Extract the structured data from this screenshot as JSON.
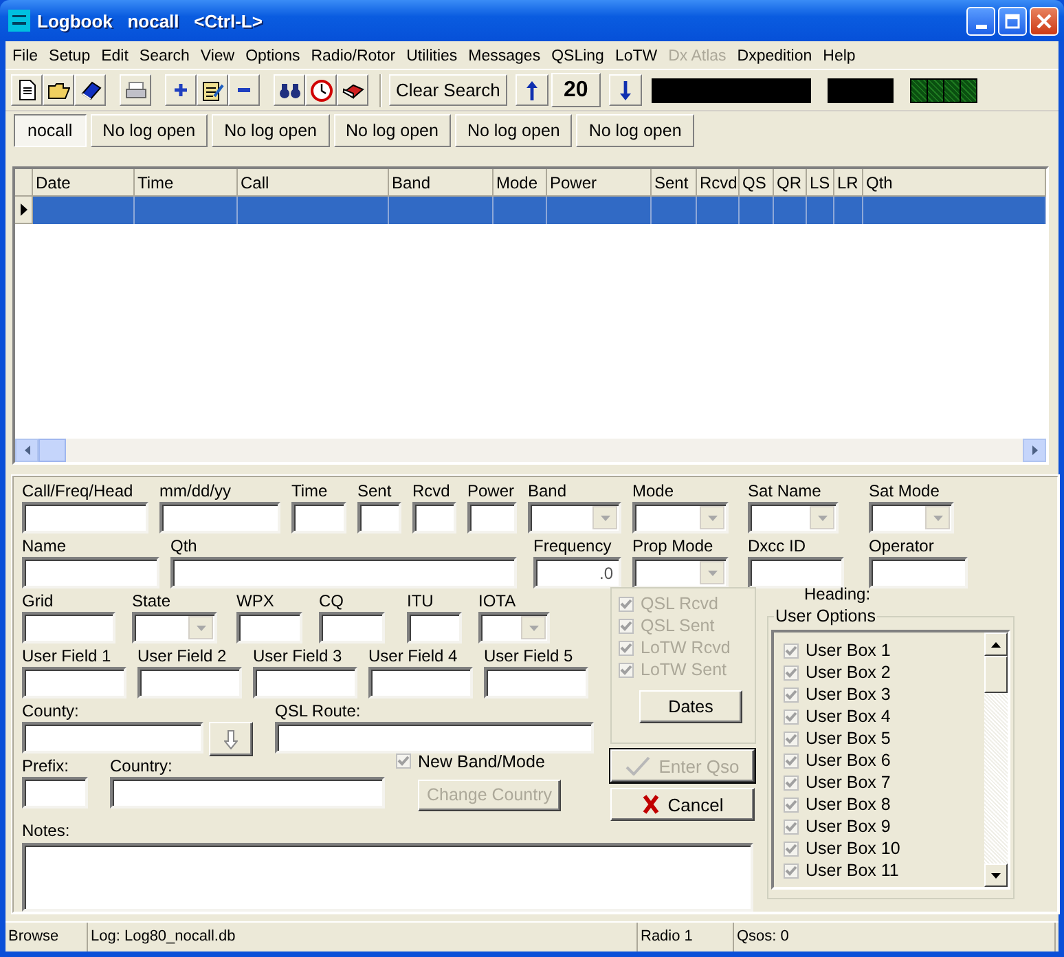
{
  "window": {
    "title": "Logbook   nocall   <Ctrl-L>"
  },
  "menu": [
    {
      "label": "File",
      "disabled": false
    },
    {
      "label": "Setup",
      "disabled": false
    },
    {
      "label": "Edit",
      "disabled": false
    },
    {
      "label": "Search",
      "disabled": false
    },
    {
      "label": "View",
      "disabled": false
    },
    {
      "label": "Options",
      "disabled": false
    },
    {
      "label": "Radio/Rotor",
      "disabled": false
    },
    {
      "label": "Utilities",
      "disabled": false
    },
    {
      "label": "Messages",
      "disabled": false
    },
    {
      "label": "QSLing",
      "disabled": false
    },
    {
      "label": "LoTW",
      "disabled": false
    },
    {
      "label": "Dx Atlas",
      "disabled": true
    },
    {
      "label": "Dxpedition",
      "disabled": false
    },
    {
      "label": "Help",
      "disabled": false
    }
  ],
  "toolbar": {
    "clear_search": "Clear Search",
    "counter": "20"
  },
  "tabs": [
    {
      "label": "nocall",
      "selected": true
    },
    {
      "label": "No log open",
      "selected": false
    },
    {
      "label": "No log open",
      "selected": false
    },
    {
      "label": "No log open",
      "selected": false
    },
    {
      "label": "No log open",
      "selected": false
    },
    {
      "label": "No log open",
      "selected": false
    }
  ],
  "table": {
    "columns": [
      "Date",
      "Time",
      "Call",
      "Band",
      "Mode",
      "Power",
      "Sent",
      "Rcvd",
      "QS",
      "QR",
      "LS",
      "LR",
      "Qth"
    ],
    "rows": [
      {
        "selected": true
      }
    ]
  },
  "form": {
    "line_1": [
      {
        "kind": "text",
        "label": "Call/Freq/Head"
      },
      {
        "kind": "text",
        "label": "mm/dd/yy"
      },
      {
        "kind": "text",
        "label": "Time"
      },
      {
        "kind": "text",
        "label": "Sent"
      },
      {
        "kind": "text",
        "label": "Rcvd"
      },
      {
        "kind": "text",
        "label": "Power"
      },
      {
        "kind": "combo",
        "label": "Band"
      },
      {
        "kind": "combo",
        "label": "Mode"
      },
      {
        "kind": "combo",
        "label": "Sat Name"
      },
      {
        "kind": "combo",
        "label": "Sat Mode"
      }
    ],
    "line_2": [
      {
        "kind": "text",
        "label": "Name"
      },
      {
        "kind": "text",
        "label": "Qth"
      },
      {
        "kind": "numeric",
        "label": "Frequency",
        "value": ".0"
      },
      {
        "kind": "combo",
        "label": "Prop Mode"
      },
      {
        "kind": "text",
        "label": "Dxcc ID"
      },
      {
        "kind": "text",
        "label": "Operator"
      }
    ],
    "line_3": [
      {
        "kind": "text",
        "label": "Grid"
      },
      {
        "kind": "combo",
        "label": "State"
      },
      {
        "kind": "text",
        "label": "WPX"
      },
      {
        "kind": "text",
        "label": "CQ"
      },
      {
        "kind": "text",
        "label": "ITU"
      },
      {
        "kind": "combo",
        "label": "IOTA"
      }
    ],
    "line_4": [
      {
        "kind": "text",
        "label": "User Field 1"
      },
      {
        "kind": "text",
        "label": "User Field 2"
      },
      {
        "kind": "text",
        "label": "User Field 3"
      },
      {
        "kind": "text",
        "label": "User Field 4"
      },
      {
        "kind": "text",
        "label": "User Field 5"
      }
    ],
    "county": {
      "label": "County:"
    },
    "qsl_route": {
      "label": "QSL Route:"
    },
    "prefix": {
      "label": "Prefix:"
    },
    "country": {
      "label": "Country:"
    },
    "new_band_mode": {
      "label": "New Band/Mode",
      "checked": true
    },
    "change_country": {
      "label": "Change Country",
      "disabled": true
    },
    "notes": {
      "label": "Notes:"
    },
    "qsl_flags": [
      {
        "label": "QSL Rcvd",
        "checked": true
      },
      {
        "label": "QSL Sent",
        "checked": true
      },
      {
        "label": "LoTW Rcvd",
        "checked": true
      },
      {
        "label": "LoTW Sent",
        "checked": true
      }
    ],
    "dates_button": "Dates",
    "enter_button": {
      "label": "Enter Qso",
      "disabled": true
    },
    "cancel_button": {
      "label": "Cancel",
      "disabled": false
    },
    "heading": "Heading:",
    "user_options": {
      "title": "User Options",
      "items": [
        {
          "label": "User Box 1",
          "checked": true
        },
        {
          "label": "User Box 2",
          "checked": true
        },
        {
          "label": "User Box 3",
          "checked": true
        },
        {
          "label": "User Box 4",
          "checked": true
        },
        {
          "label": "User Box 5",
          "checked": true
        },
        {
          "label": "User Box 6",
          "checked": true
        },
        {
          "label": "User Box 7",
          "checked": true
        },
        {
          "label": "User Box 8",
          "checked": true
        },
        {
          "label": "User Box 9",
          "checked": true
        },
        {
          "label": "User Box 10",
          "checked": true
        },
        {
          "label": "User Box 11",
          "checked": true
        }
      ]
    }
  },
  "status_bar": [
    "Browse",
    "Log: Log80_nocall.db",
    "Radio 1",
    "Qsos: 0"
  ]
}
